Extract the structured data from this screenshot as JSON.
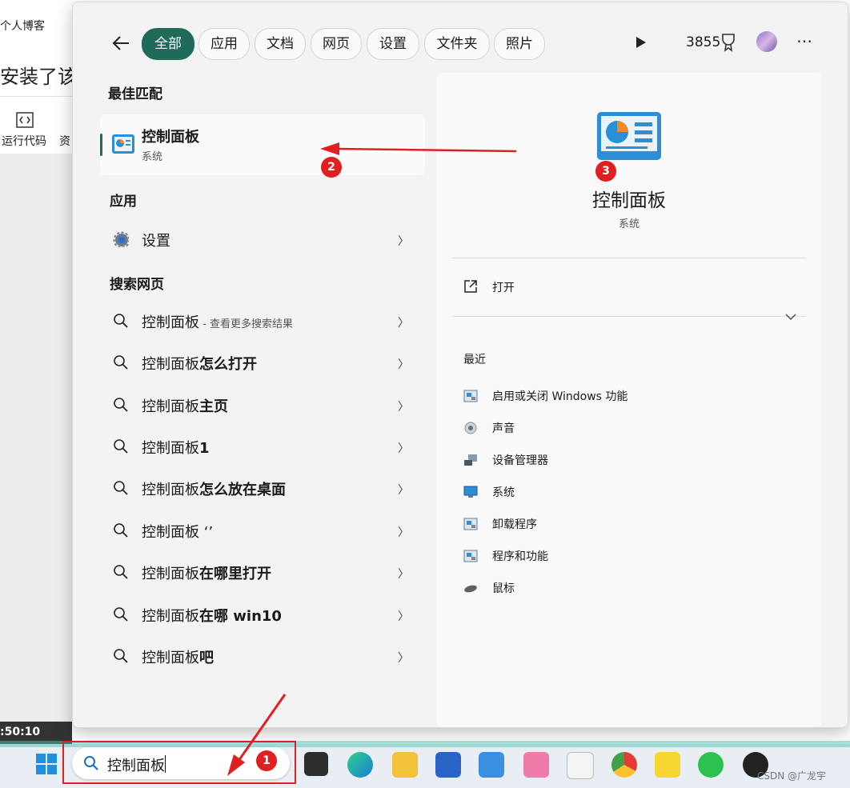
{
  "background": {
    "blog_label": "个人博客",
    "installed_text": "安装了该产",
    "run_code_label": "运行代码",
    "resource_label": "资",
    "clock_text": ":50:10"
  },
  "filters": [
    {
      "label": "全部",
      "active": true
    },
    {
      "label": "应用"
    },
    {
      "label": "文档"
    },
    {
      "label": "网页"
    },
    {
      "label": "设置"
    },
    {
      "label": "文件夹"
    },
    {
      "label": "照片"
    }
  ],
  "header": {
    "points": "3855"
  },
  "best_match": {
    "section_title": "最佳匹配",
    "name": "控制面板",
    "type": "系统"
  },
  "apps": {
    "section_title": "应用",
    "items": [
      {
        "label": "设置"
      }
    ]
  },
  "web": {
    "section_title": "搜索网页",
    "items": [
      {
        "prefix": "控制面板",
        "suffix": "",
        "hint": " - 查看更多搜索结果"
      },
      {
        "prefix": "控制面板",
        "suffix": "怎么打开",
        "hint": ""
      },
      {
        "prefix": "控制面板",
        "suffix": "主页",
        "hint": ""
      },
      {
        "prefix": "控制面板",
        "suffix": "1",
        "hint": ""
      },
      {
        "prefix": "控制面板",
        "suffix": "怎么放在桌面",
        "hint": ""
      },
      {
        "prefix": "控制面板 ‘’",
        "suffix": "",
        "hint": ""
      },
      {
        "prefix": "控制面板",
        "suffix": "在哪里打开",
        "hint": ""
      },
      {
        "prefix": "控制面板",
        "suffix": "在哪 win10",
        "hint": ""
      },
      {
        "prefix": "控制面板",
        "suffix": "吧",
        "hint": ""
      }
    ]
  },
  "detail": {
    "title": "控制面板",
    "type": "系统",
    "open_label": "打开",
    "recent_title": "最近",
    "recent": [
      {
        "label": "启用或关闭 Windows 功能"
      },
      {
        "label": "声音"
      },
      {
        "label": "设备管理器"
      },
      {
        "label": "系统"
      },
      {
        "label": "卸载程序"
      },
      {
        "label": "程序和功能"
      },
      {
        "label": "鼠标"
      }
    ]
  },
  "taskbar": {
    "search_value": "控制面板",
    "watermark": "CSDN @广龙宇"
  },
  "annotations": [
    "1",
    "2",
    "3"
  ],
  "colors": {
    "accent": "#1f6b5a",
    "annotation_red": "#e02020"
  }
}
